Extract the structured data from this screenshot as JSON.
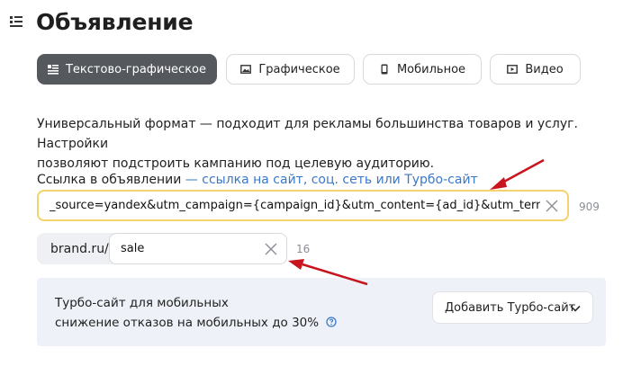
{
  "header": {
    "title": "Объявление"
  },
  "tabs": [
    {
      "label": "Текстово-графическое",
      "active": true,
      "icon": "text-graphic-icon"
    },
    {
      "label": "Графическое",
      "active": false,
      "icon": "image-icon"
    },
    {
      "label": "Мобильное",
      "active": false,
      "icon": "mobile-icon"
    },
    {
      "label": "Видео",
      "active": false,
      "icon": "video-icon"
    }
  ],
  "description": {
    "line1": "Универсальный формат — подходит для рекламы большинства товаров и услуг. Настройки",
    "line2": "позволяют подстроить кампанию под целевую аудиторию."
  },
  "link_section": {
    "label": "Ссылка в объявлении",
    "hint": " — ссылка на сайт, соц. сеть или Турбо-сайт",
    "url_value": "_source=yandex&utm_campaign={campaign_id}&utm_content={ad_id}&utm_term={keyword}",
    "url_counter": "909"
  },
  "display_link": {
    "domain": "brand.ru/",
    "path_value": "sale",
    "path_counter": "16"
  },
  "turbo": {
    "text_line1": "Турбо-сайт для мобильных",
    "text_line2": "снижение отказов на мобильных до 30%",
    "button_label": "Добавить Турбо-сайт"
  },
  "colors": {
    "active_tab": "#55595e",
    "focus_border": "#f3d36b",
    "link_hint": "#3a78c9",
    "turbo_bg": "#eef1f8",
    "annotation_arrow": "#c8141e"
  }
}
